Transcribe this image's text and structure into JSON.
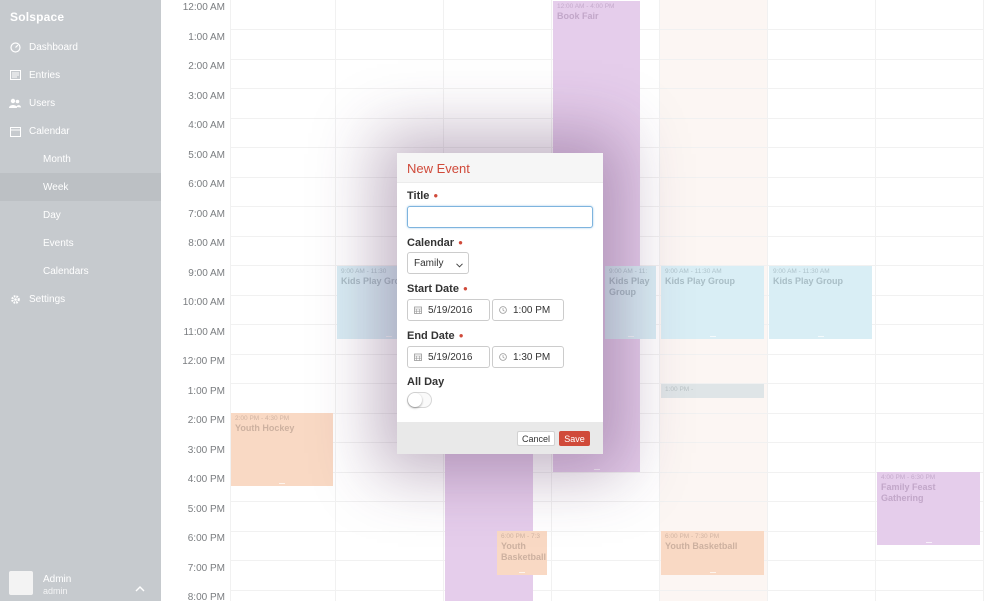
{
  "app": {
    "brand": "Solspace"
  },
  "sidebar": {
    "items": [
      {
        "label": "Dashboard",
        "icon": "dashboard-icon"
      },
      {
        "label": "Entries",
        "icon": "entries-icon"
      },
      {
        "label": "Users",
        "icon": "users-icon"
      },
      {
        "label": "Calendar",
        "icon": "calendar-icon"
      },
      {
        "label": "Month"
      },
      {
        "label": "Week",
        "active": true
      },
      {
        "label": "Day"
      },
      {
        "label": "Events"
      },
      {
        "label": "Calendars"
      },
      {
        "label": "Settings",
        "icon": "gear-icon"
      }
    ],
    "user": {
      "name": "Admin",
      "role": "admin"
    }
  },
  "calendar": {
    "times": [
      "12:00 AM",
      "1:00 AM",
      "2:00 AM",
      "3:00 AM",
      "4:00 AM",
      "5:00 AM",
      "6:00 AM",
      "7:00 AM",
      "8:00 AM",
      "9:00 AM",
      "10:00 AM",
      "11:00 AM",
      "12:00 PM",
      "1:00 PM",
      "2:00 PM",
      "3:00 PM",
      "4:00 PM",
      "5:00 PM",
      "6:00 PM",
      "7:00 PM",
      "8:00 PM"
    ],
    "events": [
      {
        "time": "12:00 AM - 4:00 PM",
        "name": "Book Fair"
      },
      {
        "time": "9:00 AM - 11:30",
        "name": "Kids Play Grou"
      },
      {
        "time": "9:00 AM - 11:",
        "name": "Kids Play Group"
      },
      {
        "time": "9:00 AM - 11:30 AM",
        "name": "Kids Play Group"
      },
      {
        "time": "9:00 AM - 11:30 AM",
        "name": "Kids Play Group"
      },
      {
        "time": "1:00 PM -",
        "name": ""
      },
      {
        "time": "2:00 PM - 4:30 PM",
        "name": "Youth Hockey"
      },
      {
        "time": "4:00 PM - 6:30 PM",
        "name": "Family Feast Gathering"
      },
      {
        "time": "6:00 PM - 7:3",
        "name": "Youth Basketball"
      },
      {
        "time": "6:00 PM - 7:30 PM",
        "name": "Youth Basketball"
      }
    ]
  },
  "modal": {
    "title": "New Event",
    "title_label": "Title",
    "title_value": "",
    "calendar_label": "Calendar",
    "calendar_value": "Family",
    "start_label": "Start Date",
    "start_date": "5/19/2016",
    "start_time": "1:00 PM",
    "end_label": "End Date",
    "end_date": "5/19/2016",
    "end_time": "1:30 PM",
    "allday_label": "All Day",
    "allday_on": false,
    "cancel_label": "Cancel",
    "save_label": "Save",
    "accent_color": "#d04a3a"
  }
}
